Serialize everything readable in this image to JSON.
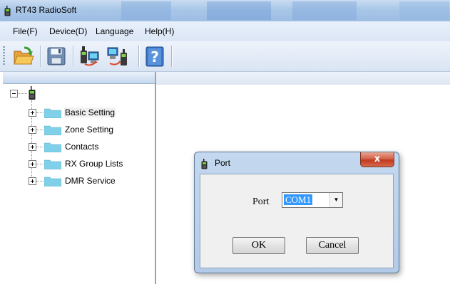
{
  "window": {
    "title": "RT43 RadioSoft"
  },
  "menu": [
    {
      "label": "File(F)"
    },
    {
      "label": "Device(D)"
    },
    {
      "label": "Language"
    },
    {
      "label": "Help(H)"
    }
  ],
  "toolbar": {
    "buttons": [
      {
        "icon": "open-folder-icon"
      },
      {
        "icon": "save-disk-icon"
      },
      {
        "icon": "read-from-radio-icon"
      },
      {
        "icon": "write-to-radio-icon"
      },
      {
        "icon": "help-icon"
      }
    ]
  },
  "tree": {
    "root_icon": "radio-icon",
    "items": [
      {
        "label": "Basic Setting",
        "selected": true
      },
      {
        "label": "Zone Setting"
      },
      {
        "label": "Contacts"
      },
      {
        "label": "RX Group Lists"
      },
      {
        "label": "DMR Service"
      }
    ]
  },
  "dialog": {
    "title": "Port",
    "close_glyph": "x",
    "port_label": "Port",
    "port_value": "COM1",
    "ok_label": "OK",
    "cancel_label": "Cancel"
  },
  "colors": {
    "selection": "#3399ff",
    "folder": "#7fd0e8",
    "close_button": "#c94a2e"
  }
}
